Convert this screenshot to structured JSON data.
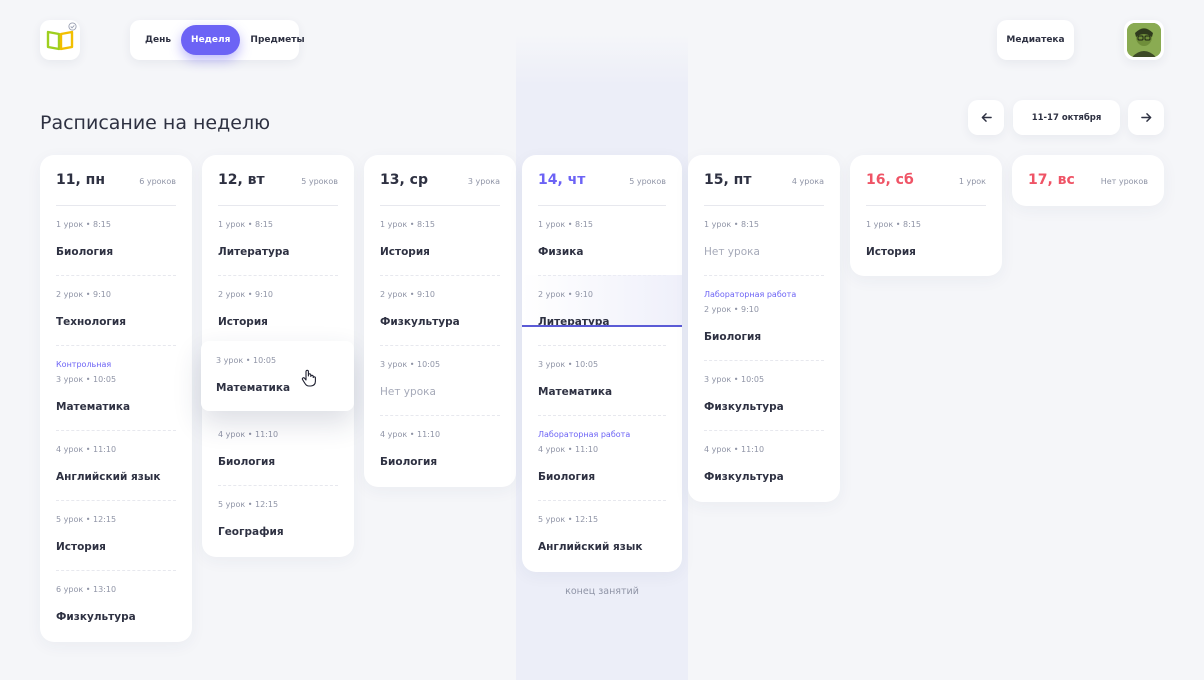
{
  "tabs": [
    {
      "label": "День",
      "active": false
    },
    {
      "label": "Неделя",
      "active": true
    },
    {
      "label": "Предметы",
      "active": false
    }
  ],
  "media_label": "Медиатека",
  "page_title": "Расписание на неделю",
  "week_range": "11-17 октября",
  "accent_color": "#6c63f5",
  "weekend_color": "#ef5466",
  "days": [
    {
      "date": "11, пн",
      "count": "6 уроков",
      "lessons": [
        {
          "time": "1 урок • 8:15",
          "subject": "Биология"
        },
        {
          "time": "2 урок • 9:10",
          "subject": "Технология"
        },
        {
          "tag": "Контрольная",
          "time": "3 урок • 10:05",
          "subject": "Математика"
        },
        {
          "time": "4 урок • 11:10",
          "subject": "Английский язык"
        },
        {
          "time": "5 урок • 12:15",
          "subject": "История"
        },
        {
          "time": "6 урок • 13:10",
          "subject": "Физкультура"
        }
      ]
    },
    {
      "date": "12, вт",
      "count": "5 уроков",
      "lessons": [
        {
          "time": "1 урок • 8:15",
          "subject": "Литература"
        },
        {
          "time": "2 урок • 9:10",
          "subject": "История"
        },
        {
          "time": "3 урок • 10:05",
          "subject": "Математика"
        },
        {
          "time": "4 урок • 11:10",
          "subject": "Биология"
        },
        {
          "time": "5 урок • 12:15",
          "subject": "География"
        }
      ]
    },
    {
      "date": "13, ср",
      "count": "3 урока",
      "lessons": [
        {
          "time": "1 урок • 8:15",
          "subject": "История"
        },
        {
          "time": "2 урок • 9:10",
          "subject": "Физкультура"
        },
        {
          "time": "3 урок • 10:05",
          "subject": "Нет урока",
          "empty": true
        },
        {
          "time": "4 урок • 11:10",
          "subject": "Биология"
        }
      ]
    },
    {
      "date": "14, чт",
      "count": "5 уроков",
      "today": true,
      "lessons": [
        {
          "time": "1 урок • 8:15",
          "subject": "Физика"
        },
        {
          "time": "2 урок • 9:10",
          "subject": "Литература"
        },
        {
          "time": "3 урок • 10:05",
          "subject": "Математика"
        },
        {
          "tag": "Лабораторная работа",
          "time": "4 урок • 11:10",
          "subject": "Биология"
        },
        {
          "time": "5 урок • 12:15",
          "subject": "Английский язык"
        }
      ],
      "end_label": "конец занятий"
    },
    {
      "date": "15, пт",
      "count": "4 урока",
      "lessons": [
        {
          "time": "1 урок • 8:15",
          "subject": "Нет урока",
          "empty": true
        },
        {
          "tag": "Лабораторная работа",
          "time": "2 урок • 9:10",
          "subject": "Биология"
        },
        {
          "time": "3 урок • 10:05",
          "subject": "Физкультура"
        },
        {
          "time": "4 урок • 11:10",
          "subject": "Физкультура"
        }
      ]
    },
    {
      "date": "16, сб",
      "count": "1 урок",
      "weekend": true,
      "lessons": [
        {
          "time": "1 урок • 8:15",
          "subject": "История"
        }
      ]
    },
    {
      "date": "17, вс",
      "count": "Нет уроков",
      "weekend": true,
      "lessons": []
    }
  ]
}
